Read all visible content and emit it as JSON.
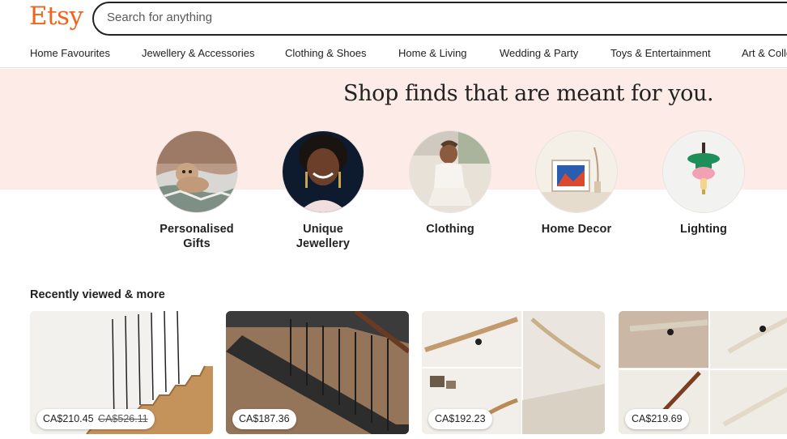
{
  "header": {
    "logo": "Etsy",
    "search_placeholder": "Search for anything"
  },
  "nav": {
    "categories": [
      "Home Favourites",
      "Jewellery & Accessories",
      "Clothing & Shoes",
      "Home & Living",
      "Wedding & Party",
      "Toys & Entertainment",
      "Art & Colle"
    ]
  },
  "hero": {
    "title": "Shop finds that are meant for you.",
    "categories": [
      {
        "line1": "Personalised",
        "line2": "Gifts"
      },
      {
        "line1": "Unique",
        "line2": "Jewellery"
      },
      {
        "line1": "Clothing",
        "line2": ""
      },
      {
        "line1": "Home Decor",
        "line2": ""
      },
      {
        "line1": "Lighting",
        "line2": ""
      }
    ]
  },
  "recent": {
    "title": "Recently viewed & more",
    "items": [
      {
        "price": "CA$210.45",
        "old_price": "CA$526.11"
      },
      {
        "price": "CA$187.36",
        "old_price": ""
      },
      {
        "price": "CA$192.23",
        "old_price": ""
      },
      {
        "price": "CA$219.69",
        "old_price": ""
      }
    ]
  },
  "colors": {
    "brand": "#F1641E",
    "hero_band": "#FDEBE7",
    "text": "#222222"
  }
}
